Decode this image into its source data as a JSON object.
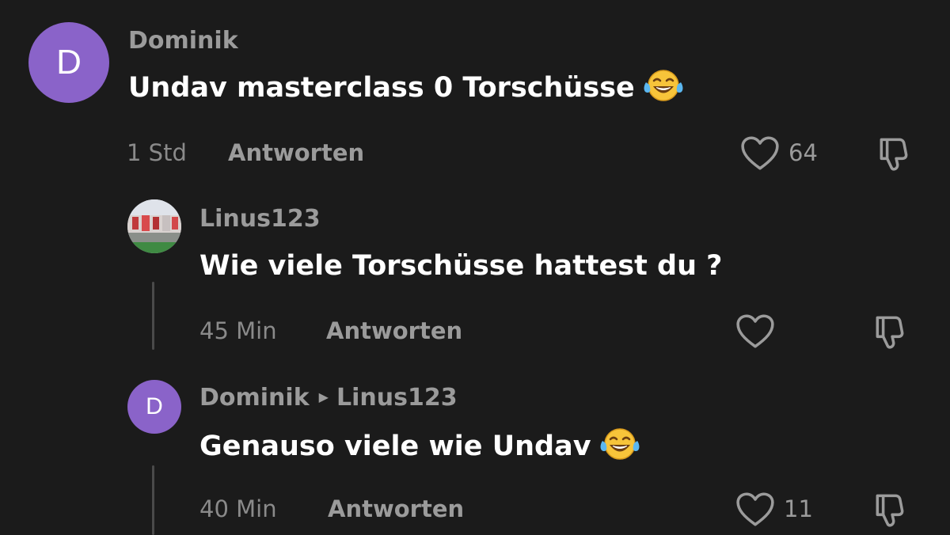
{
  "comments": [
    {
      "avatar_letter": "D",
      "username": "Dominik",
      "text": "Undav masterclass 0 Torschüsse",
      "emoji": "face-with-tears-of-joy",
      "time": "1 Std",
      "reply_label": "Antworten",
      "likes": "64"
    },
    {
      "username": "Linus123",
      "avatar": "stadium-photo",
      "text": "Wie viele Torschüsse hattest du ?",
      "time": "45 Min",
      "reply_label": "Antworten",
      "likes": ""
    },
    {
      "avatar_letter": "D",
      "username": "Dominik",
      "reply_to": "Linus123",
      "text": "Genauso viele wie Undav",
      "emoji": "face-with-tears-of-joy",
      "time": "40 Min",
      "reply_label": "Antworten",
      "likes": "11"
    }
  ],
  "colors": {
    "background": "#1b1b1b",
    "avatar": "#8a63c9",
    "text": "#ffffff",
    "muted": "#9b9b9b"
  }
}
